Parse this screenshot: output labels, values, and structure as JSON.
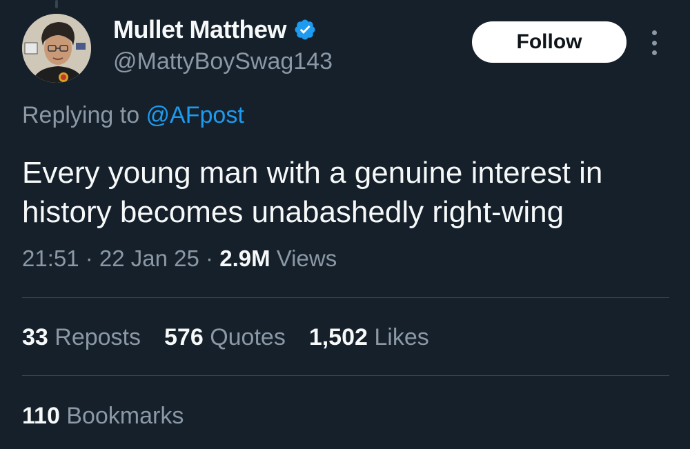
{
  "author": {
    "display_name": "Mullet Matthew",
    "handle": "@MattyBoySwag143",
    "verified_icon": "verified-badge-icon"
  },
  "follow_label": "Follow",
  "reply": {
    "prefix": "Replying to ",
    "mention": "@AFpost"
  },
  "tweet": {
    "text": "Every young man with a genuine interest in history becomes unabashedly right-wing"
  },
  "meta": {
    "time": "21:51",
    "sep1": " · ",
    "date": "22 Jan 25",
    "sep2": " · ",
    "views_count": "2.9M",
    "views_label": " Views"
  },
  "stats": {
    "reposts_count": "33",
    "reposts_label": " Reposts",
    "quotes_count": "576",
    "quotes_label": " Quotes",
    "likes_count": "1,502",
    "likes_label": " Likes",
    "bookmarks_count": "110",
    "bookmarks_label": " Bookmarks"
  },
  "colors": {
    "background": "#15202b",
    "accent": "#1d9bf0",
    "secondary_text": "#8b98a5",
    "primary_text": "#f7f9f9"
  }
}
